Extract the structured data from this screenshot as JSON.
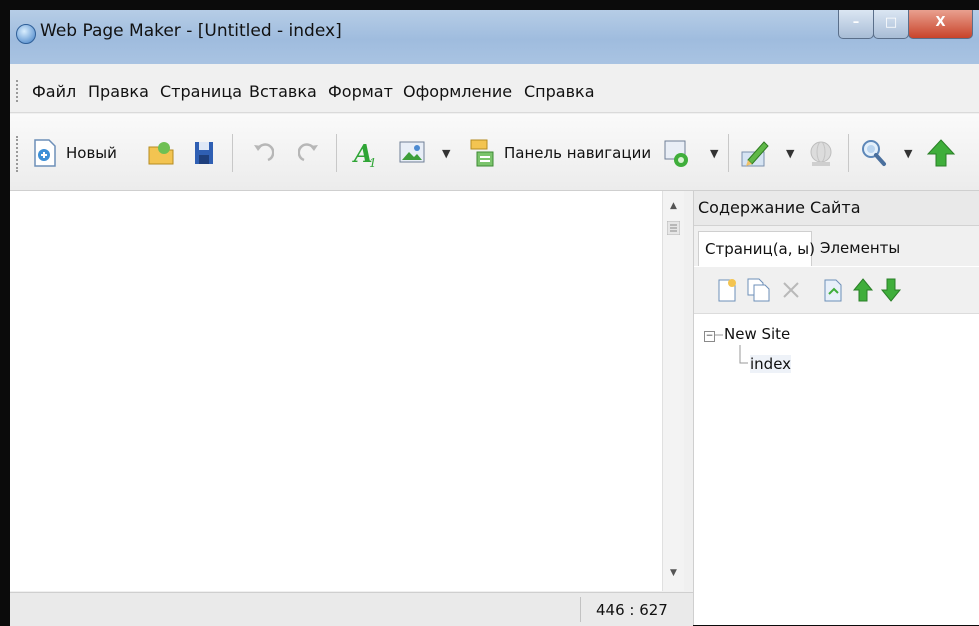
{
  "window": {
    "title": "Web Page Maker - [Untitled - index]",
    "controls": {
      "minimize": "–",
      "maximize": "□",
      "close": "X"
    }
  },
  "menu": [
    "Файл",
    "Правка",
    "Страница",
    "Вставка",
    "Формат",
    "Оформление",
    "Справка"
  ],
  "toolbar": {
    "new_label": "Новый",
    "nav_panel_label": "Панель навигации",
    "dropdown_glyph": "▼",
    "icons": [
      "new-page-icon",
      "open-folder-icon",
      "save-icon",
      "undo-icon",
      "redo-icon",
      "text-icon",
      "image-icon",
      "navigation-panel-icon",
      "preview-icon",
      "edit-pen-icon",
      "publish-icon",
      "search-zoom-icon",
      "upload-arrow-icon"
    ]
  },
  "editor": {
    "scroll_up": "▲",
    "scroll_down": "▼",
    "status_coords": "446 : 627"
  },
  "panel": {
    "title": "Содержание Сайта",
    "tabs": [
      "Страниц(а, ы)",
      "Элементы"
    ],
    "tree": {
      "root": "New Site",
      "root_toggle": "−",
      "children": [
        "index"
      ]
    },
    "toolbar_icons": [
      "add-page-icon",
      "copy-page-icon",
      "delete-icon",
      "page-properties-icon",
      "move-up-icon",
      "move-down-icon"
    ]
  },
  "colors": {
    "accent_green": "#2fa536",
    "close_red": "#c8432a",
    "title_blue": "#a9c3e2"
  }
}
